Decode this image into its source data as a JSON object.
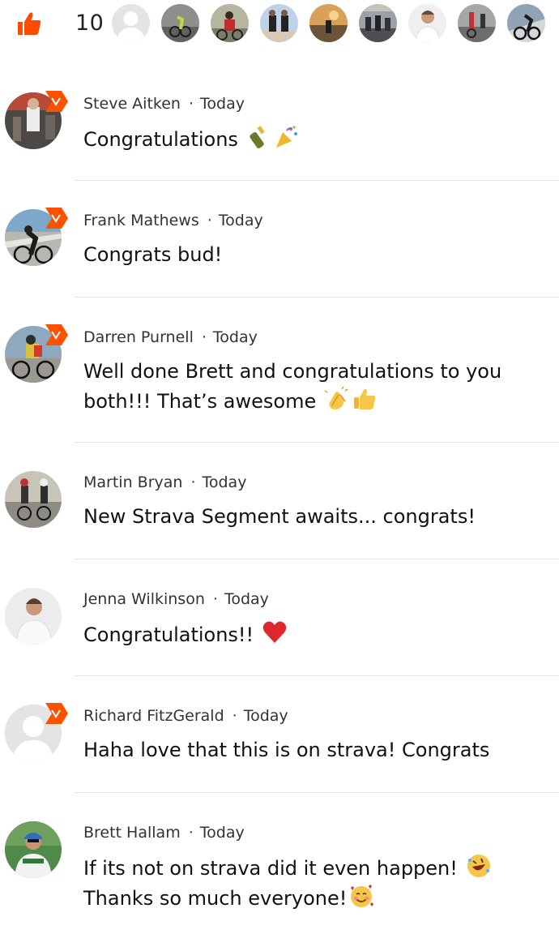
{
  "kudos": {
    "icon": "thumbs-up-icon",
    "count": "10",
    "accent": "#fc4c02"
  },
  "comments": [
    {
      "author": "Steve Aitken",
      "time": "Today",
      "text": "Congratulations",
      "emojis": [
        "bottle-icon",
        "party-popper-icon"
      ]
    },
    {
      "author": "Frank Mathews",
      "time": "Today",
      "text": "Congrats bud!",
      "emojis": []
    },
    {
      "author": "Darren Purnell",
      "time": "Today",
      "text": "Well done Brett and congratulations to you both!!! That’s awesome",
      "emojis": [
        "clapping-hands-icon",
        "thumbs-up-emoji-icon"
      ]
    },
    {
      "author": "Martin Bryan",
      "time": "Today",
      "text": "New Strava Segment awaits... congrats!",
      "emojis": []
    },
    {
      "author": "Jenna Wilkinson",
      "time": "Today",
      "text": "Congratulations!!",
      "emojis": [
        "red-heart-icon"
      ]
    },
    {
      "author": "Richard FitzGerald",
      "time": "Today",
      "text": "Haha love that this is on strava! Congrats",
      "emojis": []
    },
    {
      "author": "Brett Hallam",
      "time": "Today",
      "text": "If its not on strava did it even happen!",
      "text2": "Thanks so much everyone!",
      "emojis": [
        "rofl-face-icon",
        "smiling-face-hearts-icon"
      ]
    }
  ],
  "separator": "·"
}
